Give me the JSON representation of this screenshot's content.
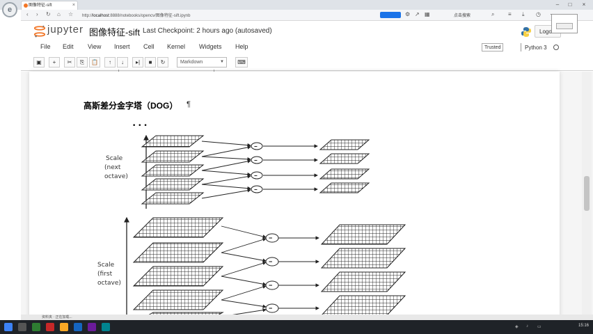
{
  "browser": {
    "tab_title": "图像特征-sift",
    "url_prefix": "http://",
    "url_host": "localhost",
    "url_rest": ":8888/notebooks/opencv/图像特征-sift.ipynb",
    "search_text": "点击搜索"
  },
  "header": {
    "logo_text": "jupyter",
    "notebook_title": "图像特征-sift",
    "checkpoint": "Last Checkpoint: 2 hours ago (autosaved)",
    "logout_label": "Logout"
  },
  "menu": {
    "items": [
      "File",
      "Edit",
      "View",
      "Insert",
      "Cell",
      "Kernel",
      "Widgets",
      "Help"
    ]
  },
  "kernel": {
    "trusted_label": "Trusted",
    "name": "Python 3"
  },
  "toolbar": {
    "celltype": "Markdown"
  },
  "cell": {
    "heading": "高斯差分金字塔（DOG）",
    "pilcrow": "¶"
  },
  "figure": {
    "ellipsis": "• • •",
    "scale_next": [
      "Scale",
      "(next",
      "octave)"
    ],
    "scale_first": [
      "Scale",
      "(first",
      "octave)"
    ],
    "minus": "−"
  },
  "status": {
    "left_text": "资料夹 · 正在加载..."
  },
  "taskbar": {
    "clock": "15:16"
  },
  "colors": {
    "jupyter_orange": "#f37626",
    "taskbar": "#1f2328",
    "grid_line": "#222222"
  }
}
